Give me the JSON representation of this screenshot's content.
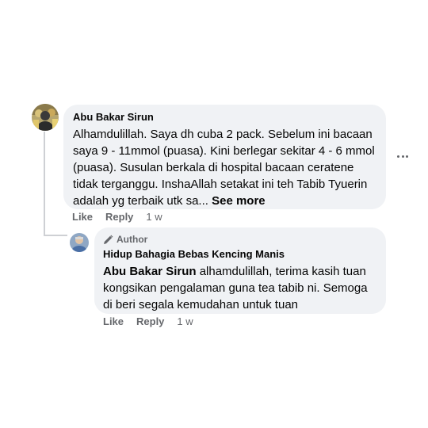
{
  "comment": {
    "author": "Abu Bakar Sirun",
    "text": "Alhamdulillah. Saya dh cuba 2 pack. Sebelum ini bacaan saya 9 - 11mmol (puasa). Kini berlegar sekitar 4 - 6 mmol (puasa). Susulan berkala di hospital bacaan ceratene tidak terganggu. InshaAllah setakat ini teh Tabib Tyuerin adalah yg terbaik utk sa...",
    "see_more": "See more",
    "like": "Like",
    "reply": "Reply",
    "time": "1 w"
  },
  "reply": {
    "badge": "Author",
    "author": "Hidup Bahagia Bebas Kencing Manis",
    "mention": "Abu Bakar Sirun",
    "text": " alhamdulillah, terima kasih tuan kongsikan pengalaman guna tea tabib ni. Semoga di beri segala kemudahan untuk tuan",
    "like": "Like",
    "reply": "Reply",
    "time": "1 w"
  },
  "icons": {
    "more": "more-options-icon",
    "badge": "pencil-icon"
  }
}
